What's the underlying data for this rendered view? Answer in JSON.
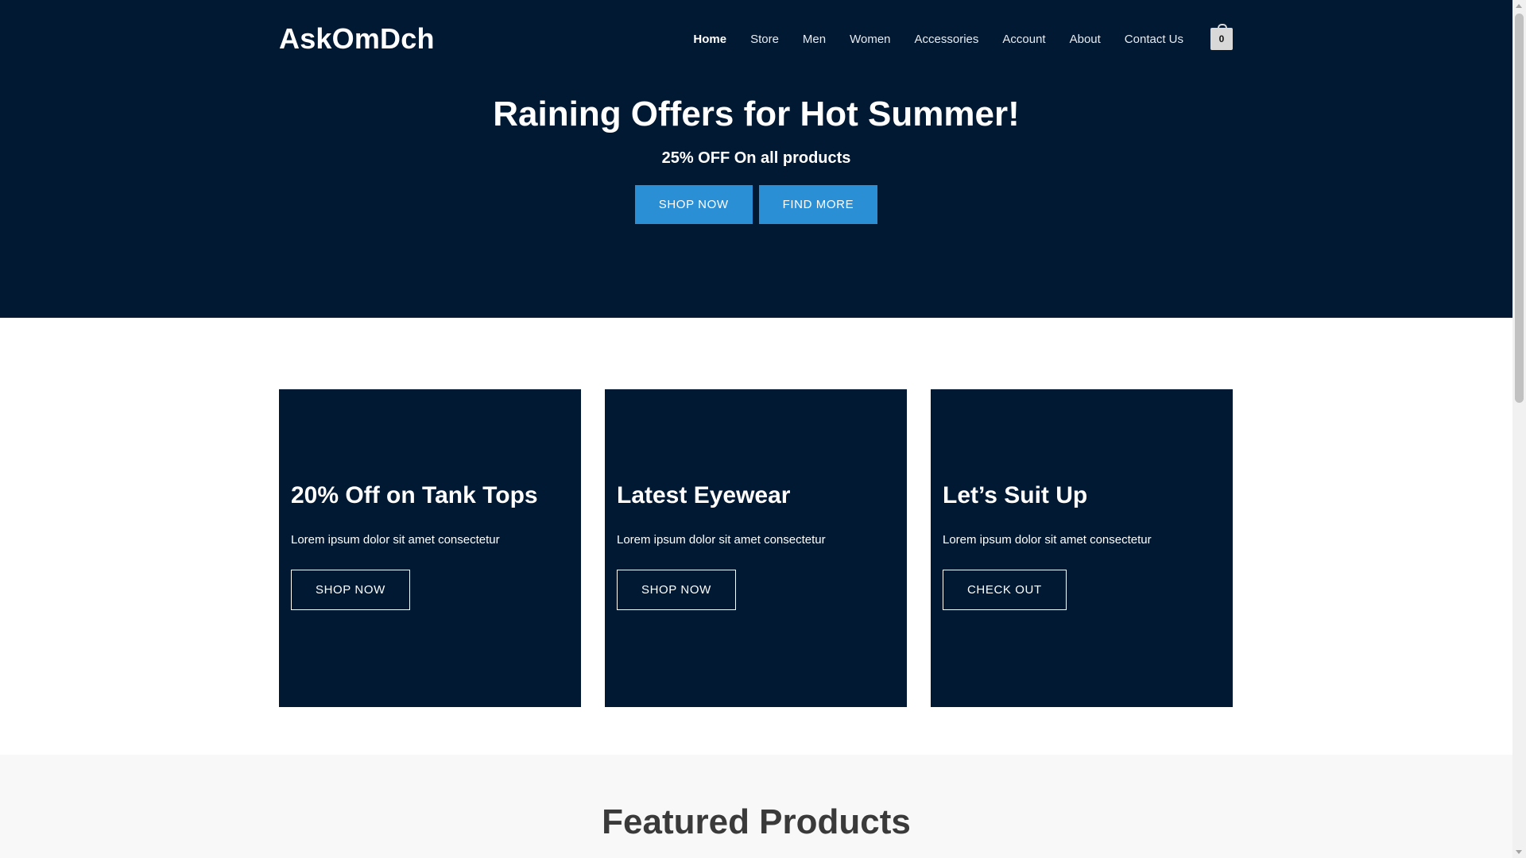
{
  "header": {
    "logo": "AskOmDch",
    "nav": [
      "Home",
      "Store",
      "Men",
      "Women",
      "Accessories",
      "Account",
      "About",
      "Contact Us"
    ],
    "active_nav": "Home",
    "cart_count": "0"
  },
  "hero": {
    "title": "Raining Offers for Hot Summer!",
    "subtitle": "25% OFF On all products",
    "buttons": [
      "SHOP NOW",
      "FIND MORE"
    ]
  },
  "promo_cards": [
    {
      "title": "20% Off on Tank Tops",
      "text": "Lorem ipsum dolor sit amet consectetur",
      "button": "SHOP NOW"
    },
    {
      "title": "Latest Eyewear",
      "text": "Lorem ipsum dolor sit amet consectetur",
      "button": "SHOP NOW"
    },
    {
      "title": "Let’s Suit Up",
      "text": "Lorem ipsum dolor sit amet consectetur",
      "button": "CHECK OUT"
    }
  ],
  "featured": {
    "title": "Featured Products"
  },
  "colors": {
    "navy": "#011932",
    "accent_blue": "#2b8fd6",
    "light_bg": "#f8f8f8"
  }
}
